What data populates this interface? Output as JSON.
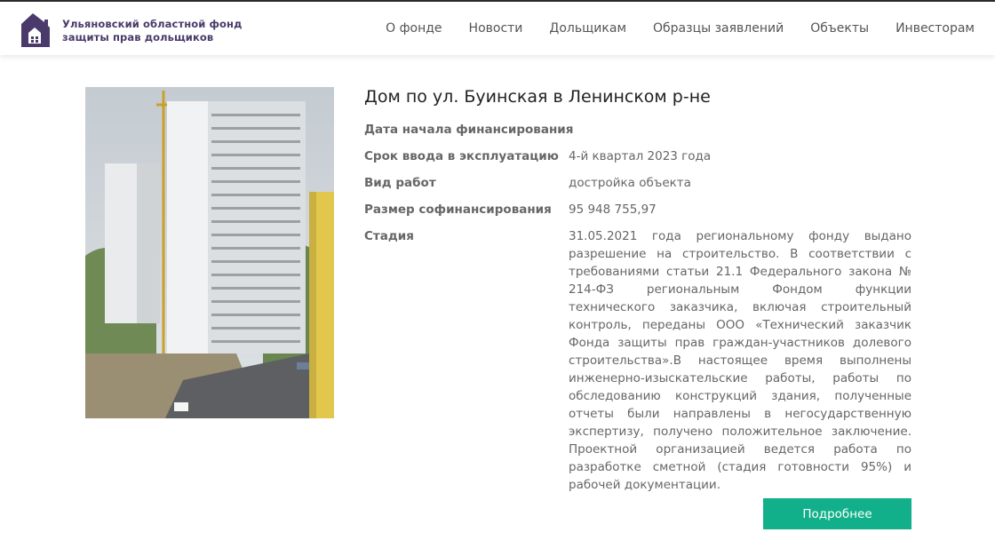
{
  "header": {
    "logo_line1": "Ульяновский областной фонд",
    "logo_line2": "защиты прав дольщиков",
    "nav": [
      "О фонде",
      "Новости",
      "Дольщикам",
      "Образцы заявлений",
      "Объекты",
      "Инвесторам"
    ]
  },
  "object": {
    "title": "Дом по ул. Буинская в Ленинском р-не",
    "rows": [
      {
        "label": "Дата начала финансирования",
        "value": "-"
      },
      {
        "label": "Срок ввода в эксплуатацию",
        "value": "4-й квартал 2023 года"
      },
      {
        "label": "Вид работ",
        "value": "достройка объекта"
      },
      {
        "label": "Размер софинансирования",
        "value": "95 948 755,97"
      },
      {
        "label": "Стадия",
        "value": "31.05.2021 года региональному фонду выдано разрешение на строительство. В соответствии с требованиями статьи 21.1 Федерального закона № 214-ФЗ региональным Фондом функции технического заказчика, включая строительный контроль, переданы ООО «Технический заказчик Фонда защиты прав граждан-участников долевого строительства».В настоящее время выполнены инженерно-изыскательские работы, работы по обследованию конструкций здания, полученные отчеты были направлены в негосударственную экспертизу, получено положительное заключение. Проектной организацией ведется работа по разработке сметной (стадия готовности 95%) и рабочей документации."
      }
    ],
    "more_button": "Подробнее"
  },
  "colors": {
    "brand": "#4a3a6b",
    "button": "#12b08a"
  }
}
